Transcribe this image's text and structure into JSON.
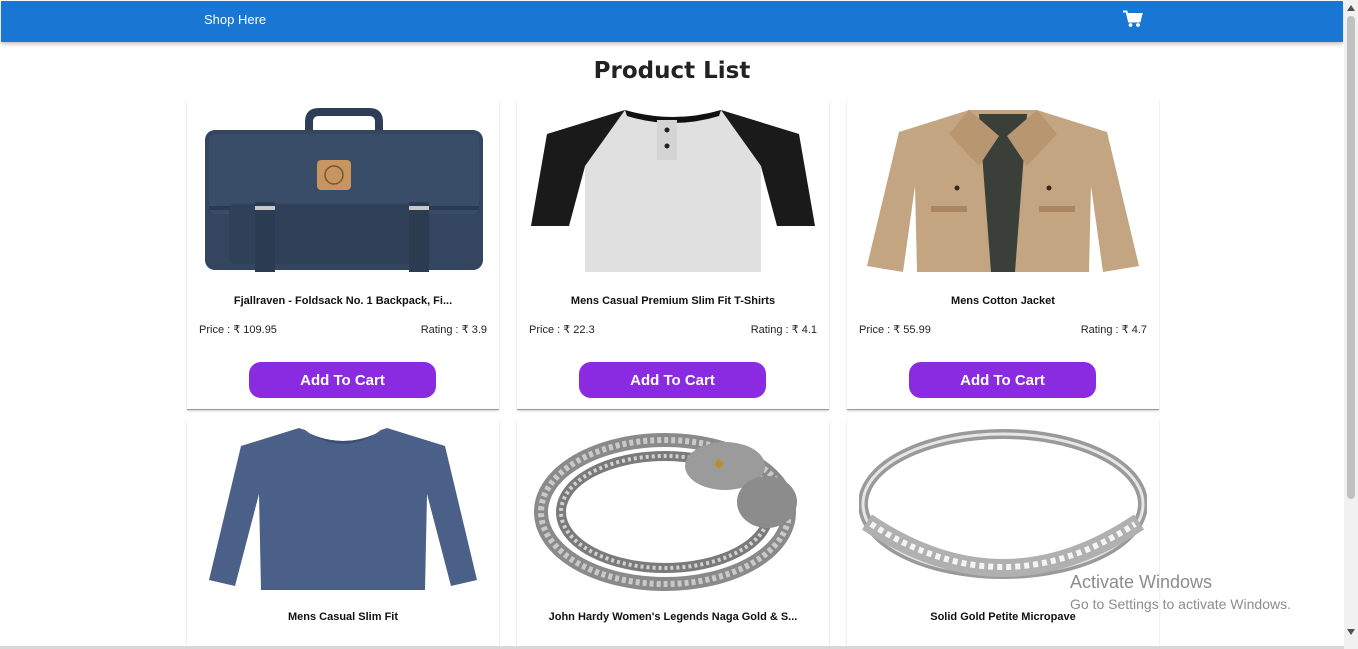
{
  "navbar": {
    "brand": "Shop Here",
    "cart_icon": "cart-icon",
    "color": "#1976d2"
  },
  "page": {
    "title": "Product List"
  },
  "products": [
    {
      "name": "Fjallraven - Foldsack No. 1 Backpack, Fi...",
      "price": "Price : ₹ 109.95",
      "rating": "Rating : ₹ 3.9",
      "button": "Add To Cart",
      "image": "backpack"
    },
    {
      "name": "Mens Casual Premium Slim Fit T-Shirts",
      "price": "Price : ₹ 22.3",
      "rating": "Rating : ₹ 4.1",
      "button": "Add To Cart",
      "image": "raglan-tshirt"
    },
    {
      "name": "Mens Cotton Jacket",
      "price": "Price : ₹ 55.99",
      "rating": "Rating : ₹ 4.7",
      "button": "Add To Cart",
      "image": "cotton-jacket"
    },
    {
      "name": "Mens Casual Slim Fit",
      "image": "long-sleeve-shirt"
    },
    {
      "name": "John Hardy Women's Legends Naga Gold & S...",
      "image": "dragon-bracelet"
    },
    {
      "name": "Solid Gold Petite Micropave",
      "image": "ring"
    }
  ],
  "button_color": "#8a2be2",
  "watermark": {
    "line1": "Activate Windows",
    "line2": "Go to Settings to activate Windows."
  }
}
